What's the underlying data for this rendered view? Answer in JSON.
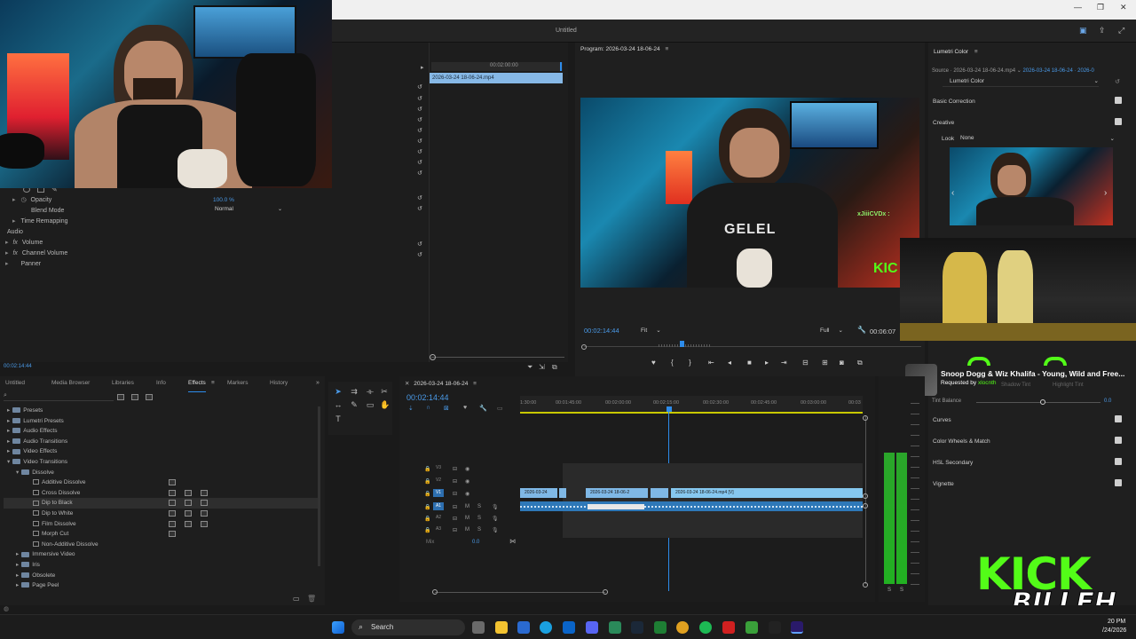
{
  "window": {
    "title": "Untitled"
  },
  "effect_controls": {
    "source_clip": "2026-03-24 18-06-24.mp4",
    "ruler_time": "00:02:00:00",
    "opacity_label": "Opacity",
    "opacity_value": "100.0 %",
    "blend_mode_label": "Blend Mode",
    "blend_mode_value": "Normal",
    "time_remapping": "Time Remapping",
    "audio_header": "Audio",
    "volume": "Volume",
    "channel_volume": "Channel Volume",
    "panner": "Panner",
    "footer_time": "00:02:14:44"
  },
  "program_monitor": {
    "title": "Program: 2026-03-24 18-06-24",
    "timecode": "00:02:14:44",
    "fit": "Fit",
    "quality": "Full",
    "duration": "00:06:07",
    "overlay_username": "xJiiiCVDx :"
  },
  "lumetri": {
    "title": "Lumetri Color",
    "source_label": "Source · 2026-03-24 18-06-24.mp4",
    "source_clip": "2026-03-24 18-06-24 · 2026-0",
    "effect_select": "Lumetri Color",
    "basic_correction": "Basic Correction",
    "creative": "Creative",
    "look_label": "Look",
    "look_value": "None",
    "white_balance": "Tint Balance",
    "white_balance_value": "0.0",
    "shadow_tint": "Shadow Tint",
    "highlight_tint": "Highlight Tint",
    "curves": "Curves",
    "color_wheels": "Color Wheels & Match",
    "hsl_secondary": "HSL Secondary",
    "vignette": "Vignette"
  },
  "now_playing": {
    "title": "Snoop Dogg & Wiz Khalifa - Young, Wild and Free...",
    "requested_prefix": "Requested by",
    "requested_by": "xlocnth"
  },
  "project_panel": {
    "tabs": [
      {
        "label": "Untitled",
        "active": false
      },
      {
        "label": "Media Browser",
        "active": false
      },
      {
        "label": "Libraries",
        "active": false
      },
      {
        "label": "Info",
        "active": false
      },
      {
        "label": "Effects",
        "active": true
      },
      {
        "label": "Markers",
        "active": false
      },
      {
        "label": "History",
        "active": false
      }
    ],
    "tree": [
      {
        "label": "Presets",
        "indent": 0,
        "kind": "folder",
        "expanded": false
      },
      {
        "label": "Lumetri Presets",
        "indent": 0,
        "kind": "folder",
        "expanded": false
      },
      {
        "label": "Audio Effects",
        "indent": 0,
        "kind": "folder",
        "expanded": false
      },
      {
        "label": "Audio Transitions",
        "indent": 0,
        "kind": "folder",
        "expanded": false
      },
      {
        "label": "Video Effects",
        "indent": 0,
        "kind": "folder",
        "expanded": false
      },
      {
        "label": "Video Transitions",
        "indent": 0,
        "kind": "folder",
        "expanded": true
      },
      {
        "label": "Dissolve",
        "indent": 1,
        "kind": "folder",
        "expanded": true
      },
      {
        "label": "Additive Dissolve",
        "indent": 2,
        "kind": "fx",
        "acc": 1
      },
      {
        "label": "Cross Dissolve",
        "indent": 2,
        "kind": "fx",
        "acc": 3
      },
      {
        "label": "Dip to Black",
        "indent": 2,
        "kind": "fx",
        "acc": 3,
        "selected": true
      },
      {
        "label": "Dip to White",
        "indent": 2,
        "kind": "fx",
        "acc": 3
      },
      {
        "label": "Film Dissolve",
        "indent": 2,
        "kind": "fx",
        "acc": 3
      },
      {
        "label": "Morph Cut",
        "indent": 2,
        "kind": "fx",
        "acc": 1
      },
      {
        "label": "Non-Additive Dissolve",
        "indent": 2,
        "kind": "fx",
        "acc": 0
      },
      {
        "label": "Immersive Video",
        "indent": 1,
        "kind": "folder",
        "expanded": false
      },
      {
        "label": "Iris",
        "indent": 1,
        "kind": "folder",
        "expanded": false
      },
      {
        "label": "Obsolete",
        "indent": 1,
        "kind": "folder",
        "expanded": false
      },
      {
        "label": "Page Peel",
        "indent": 1,
        "kind": "folder",
        "expanded": false
      }
    ]
  },
  "timeline": {
    "sequence_name": "2026-03-24 18-06-24",
    "timecode": "00:02:14:44",
    "ruler_labels": [
      "1:30:00",
      "00:01:45:00",
      "00:02:00:00",
      "00:02:15:00",
      "00:02:30:00",
      "00:02:45:00",
      "00:03:00:00",
      "00:03"
    ],
    "tracks": [
      {
        "name": "V3",
        "type": "video"
      },
      {
        "name": "V2",
        "type": "video"
      },
      {
        "name": "V1",
        "type": "video"
      },
      {
        "name": "A1",
        "type": "audio"
      },
      {
        "name": "A2",
        "type": "audio"
      },
      {
        "name": "A3",
        "type": "audio"
      }
    ],
    "mix_label": "Mix",
    "mix_value": "0.0",
    "clips": [
      {
        "label": "2026-03-24"
      },
      {
        "label": "2026-03-24 18-06-2"
      },
      {
        "label": "2026-03-24 18-06-24.mp4 [V]"
      }
    ]
  },
  "taskbar": {
    "search_label": "Search",
    "clock_time": "20 PM",
    "clock_date": "/24/2026"
  },
  "watermark": {
    "line1": "KICK",
    "line2": "BILLEH"
  }
}
